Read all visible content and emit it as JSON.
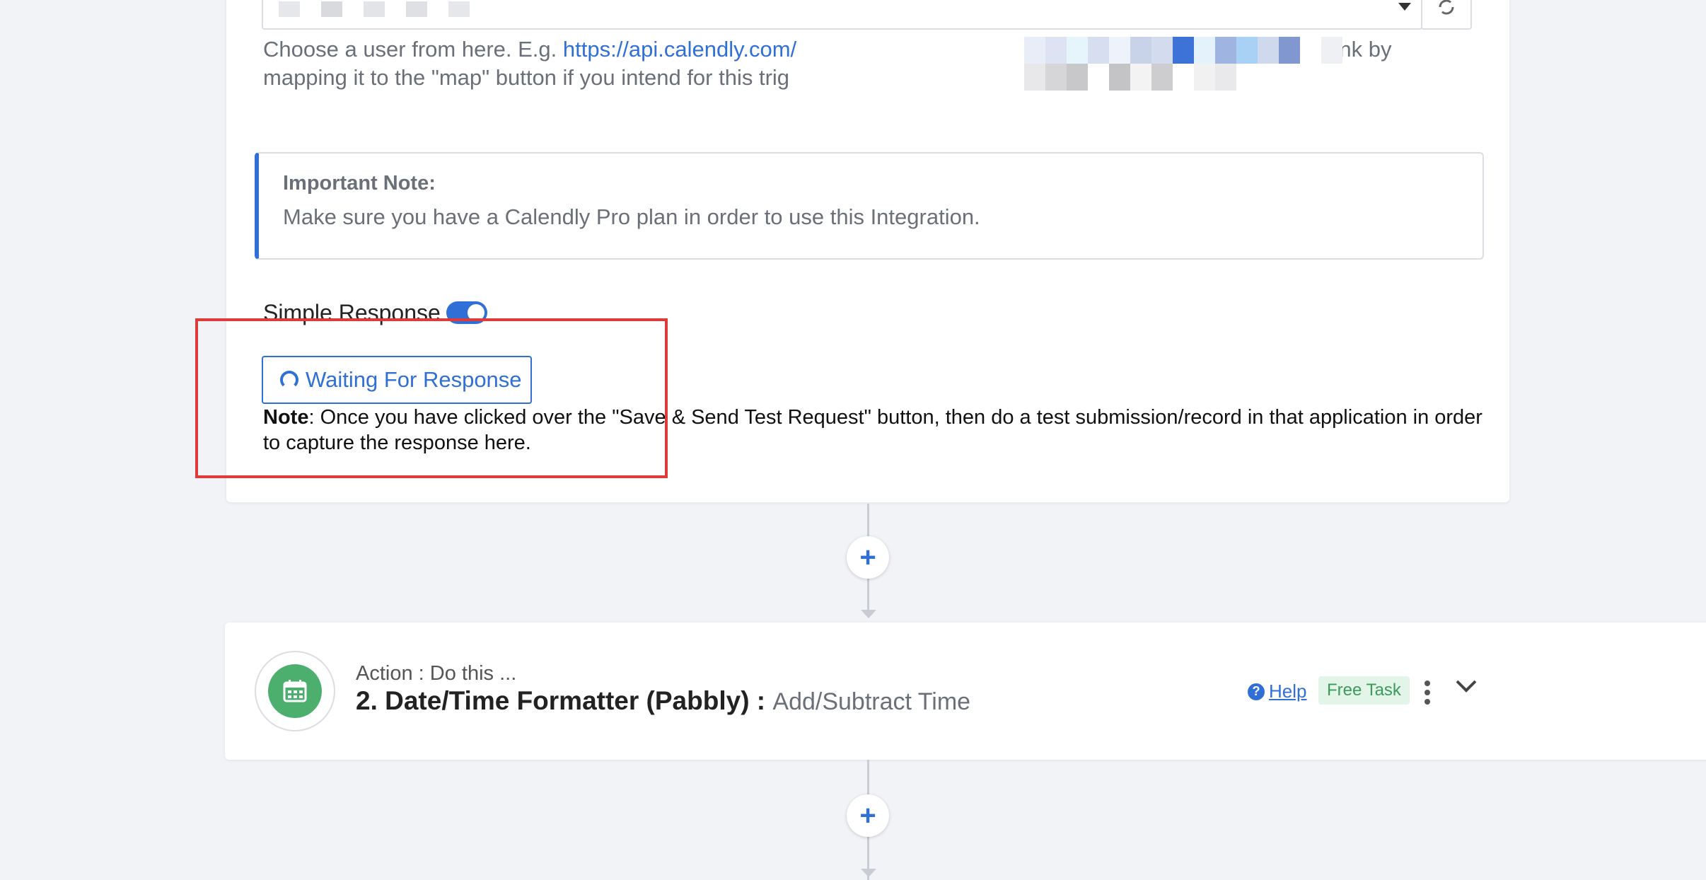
{
  "trigger": {
    "user_select_value": "",
    "help_prefix": "Choose a user from here. E.g. ",
    "help_link": "https://api.calendly.com/",
    "help_suffix_line1": "ease leave this field blank by",
    "help_line2": "mapping it to the \"map\" button if you intend for this trig",
    "important_title": "Important Note:",
    "important_body": "Make sure you have a Calendly Pro plan in order to use this Integration.",
    "simple_response_label": "Simple Response",
    "simple_response_on": true,
    "waiting_button": "Waiting For Response",
    "note_label": "Note",
    "note_text": ": Once you have clicked over the \"Save & Send Test Request\" button, then do a test submission/record in that application in order to capture the response here."
  },
  "action": {
    "subtitle": "Action : Do this ...",
    "title": "2. Date/Time Formatter (Pabbly) : ",
    "event": "Add/Subtract Time",
    "help_label": "Help",
    "badge": "Free Task",
    "icon": "calendar-icon"
  },
  "connectors": {
    "plus_symbol": "+"
  },
  "colors": {
    "accent": "#2f6fd6",
    "highlight": "#e03b3b",
    "app_green": "#4caf6e",
    "badge_bg": "#e2f5e8"
  }
}
